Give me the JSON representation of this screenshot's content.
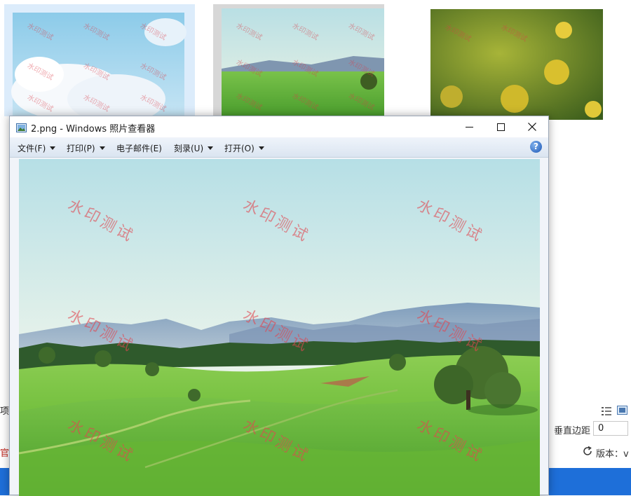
{
  "viewer": {
    "title": "2.png - Windows 照片查看器",
    "menu": {
      "file": "文件(F)",
      "print": "打印(P)",
      "email": "电子邮件(E)",
      "burn": "刻录(U)",
      "open": "打开(O)"
    },
    "help_symbol": "?",
    "icons": [
      "photo-viewer-icon",
      "minimize-icon",
      "maximize-icon",
      "close-icon",
      "help-icon",
      "dropdown-caret-icon"
    ]
  },
  "watermark": {
    "text": "水印测试"
  },
  "background": {
    "left_edge_text_1": "项目",
    "left_edge_text_2": "官",
    "vertical_margin_label": "垂直边距",
    "vertical_margin_value": "0",
    "version_label": "版本：v",
    "icons": [
      "view-details-icon",
      "view-large-icon",
      "refresh-icon"
    ]
  }
}
